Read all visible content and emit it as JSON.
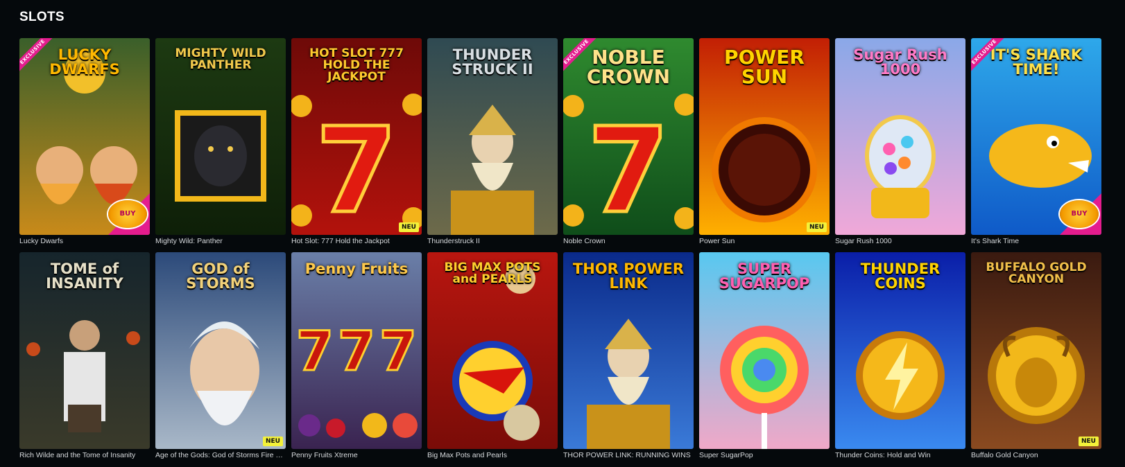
{
  "section": {
    "title": "SLOTS"
  },
  "games": [
    {
      "name": "Lucky Dwarfs",
      "logo": "LUCKY DWARFS",
      "exclusive": "EXCLUSIVE",
      "bonus": "BUY BONUS",
      "neu": "",
      "bg1": "#3a5f2a",
      "bg2": "#c88a1a",
      "logo_color": "#ffb800",
      "art": "dwarfs"
    },
    {
      "name": "Mighty Wild: Panther",
      "logo": "MIGHTY WILD PANTHER",
      "exclusive": "",
      "bonus": "",
      "neu": "",
      "bg1": "#1d3a12",
      "bg2": "#0e1f08",
      "logo_color": "#f2c94c",
      "art": "panther"
    },
    {
      "name": "Hot Slot: 777 Hold the Jackpot",
      "logo": "HOT SLOT 777 HOLD THE JACKPOT",
      "exclusive": "",
      "bonus": "",
      "neu": "NEU",
      "bg1": "#6e0a08",
      "bg2": "#b3120c",
      "logo_color": "#ffcb2e",
      "art": "seven"
    },
    {
      "name": "Thunderstruck II",
      "logo": "THUNDER STRUCK II",
      "exclusive": "",
      "bonus": "",
      "neu": "",
      "bg1": "#2f4a52",
      "bg2": "#6d6a4a",
      "logo_color": "#d9dfe3",
      "art": "thor"
    },
    {
      "name": "Noble Crown",
      "logo": "NOBLE CROWN",
      "exclusive": "EXCLUSIVE",
      "bonus": "",
      "neu": "",
      "bg1": "#2f8a2f",
      "bg2": "#0f4d1a",
      "logo_color": "#ffe28a",
      "art": "seven"
    },
    {
      "name": "Power Sun",
      "logo": "POWER SUN",
      "exclusive": "",
      "bonus": "",
      "neu": "NEU",
      "bg1": "#c21f05",
      "bg2": "#ffb000",
      "logo_color": "#ffd400",
      "art": "sun"
    },
    {
      "name": "Sugar Rush 1000",
      "logo": "Sugar Rush 1000",
      "exclusive": "",
      "bonus": "",
      "neu": "",
      "bg1": "#8aa8e8",
      "bg2": "#f0a8d8",
      "logo_color": "#ff7ac7",
      "art": "gumball"
    },
    {
      "name": "It's Shark Time",
      "logo": "IT'S SHARK TIME!",
      "exclusive": "EXCLUSIVE",
      "bonus": "BUY BONUS",
      "neu": "",
      "bg1": "#2ea8ea",
      "bg2": "#0f5ac8",
      "logo_color": "#ffe14a",
      "art": "shark"
    },
    {
      "name": "Rich Wilde and the Tome of Insanity",
      "logo": "TOME of INSANITY",
      "exclusive": "",
      "bonus": "",
      "neu": "",
      "bg1": "#16252c",
      "bg2": "#3a3a2a",
      "logo_color": "#e6e0c8",
      "art": "hero"
    },
    {
      "name": "Age of the Gods: God of Storms Fire Blaze Classics",
      "logo": "GOD of STORMS",
      "exclusive": "",
      "bonus": "",
      "neu": "NEU",
      "bg1": "#2c4a7a",
      "bg2": "#a9b8c8",
      "logo_color": "#f2d27a",
      "art": "zeus"
    },
    {
      "name": "Penny Fruits Xtreme",
      "logo": "Penny Fruits",
      "exclusive": "",
      "bonus": "",
      "neu": "",
      "bg1": "#6a7fa8",
      "bg2": "#3a2350",
      "logo_color": "#ffc94a",
      "art": "777"
    },
    {
      "name": "Big Max Pots and Pearls",
      "logo": "BIG MAX POTS and PEARLS",
      "exclusive": "",
      "bonus": "",
      "neu": "",
      "bg1": "#b8160f",
      "bg2": "#7a0c08",
      "logo_color": "#ffd02e",
      "art": "wolf"
    },
    {
      "name": "THOR POWER LINK: RUNNING WINS",
      "logo": "THOR POWER LINK",
      "exclusive": "",
      "bonus": "",
      "neu": "",
      "bg1": "#0a2a8a",
      "bg2": "#3a7ad8",
      "logo_color": "#ffb800",
      "art": "thor"
    },
    {
      "name": "Super SugarPop",
      "logo": "SUPER SUGARPOP",
      "exclusive": "",
      "bonus": "",
      "neu": "",
      "bg1": "#58c8f0",
      "bg2": "#f0a8c8",
      "logo_color": "#ff5fb0",
      "art": "lollipop"
    },
    {
      "name": "Thunder Coins: Hold and Win",
      "logo": "THUNDER COINS",
      "exclusive": "",
      "bonus": "",
      "neu": "",
      "bg1": "#0a1ea8",
      "bg2": "#3a8af0",
      "logo_color": "#ffd400",
      "art": "coin"
    },
    {
      "name": "Buffalo Gold Canyon",
      "logo": "BUFFALO GOLD CANYON",
      "exclusive": "",
      "bonus": "",
      "neu": "NEU",
      "bg1": "#3a1a10",
      "bg2": "#8a4a20",
      "logo_color": "#f2c04a",
      "art": "buffalo"
    }
  ]
}
